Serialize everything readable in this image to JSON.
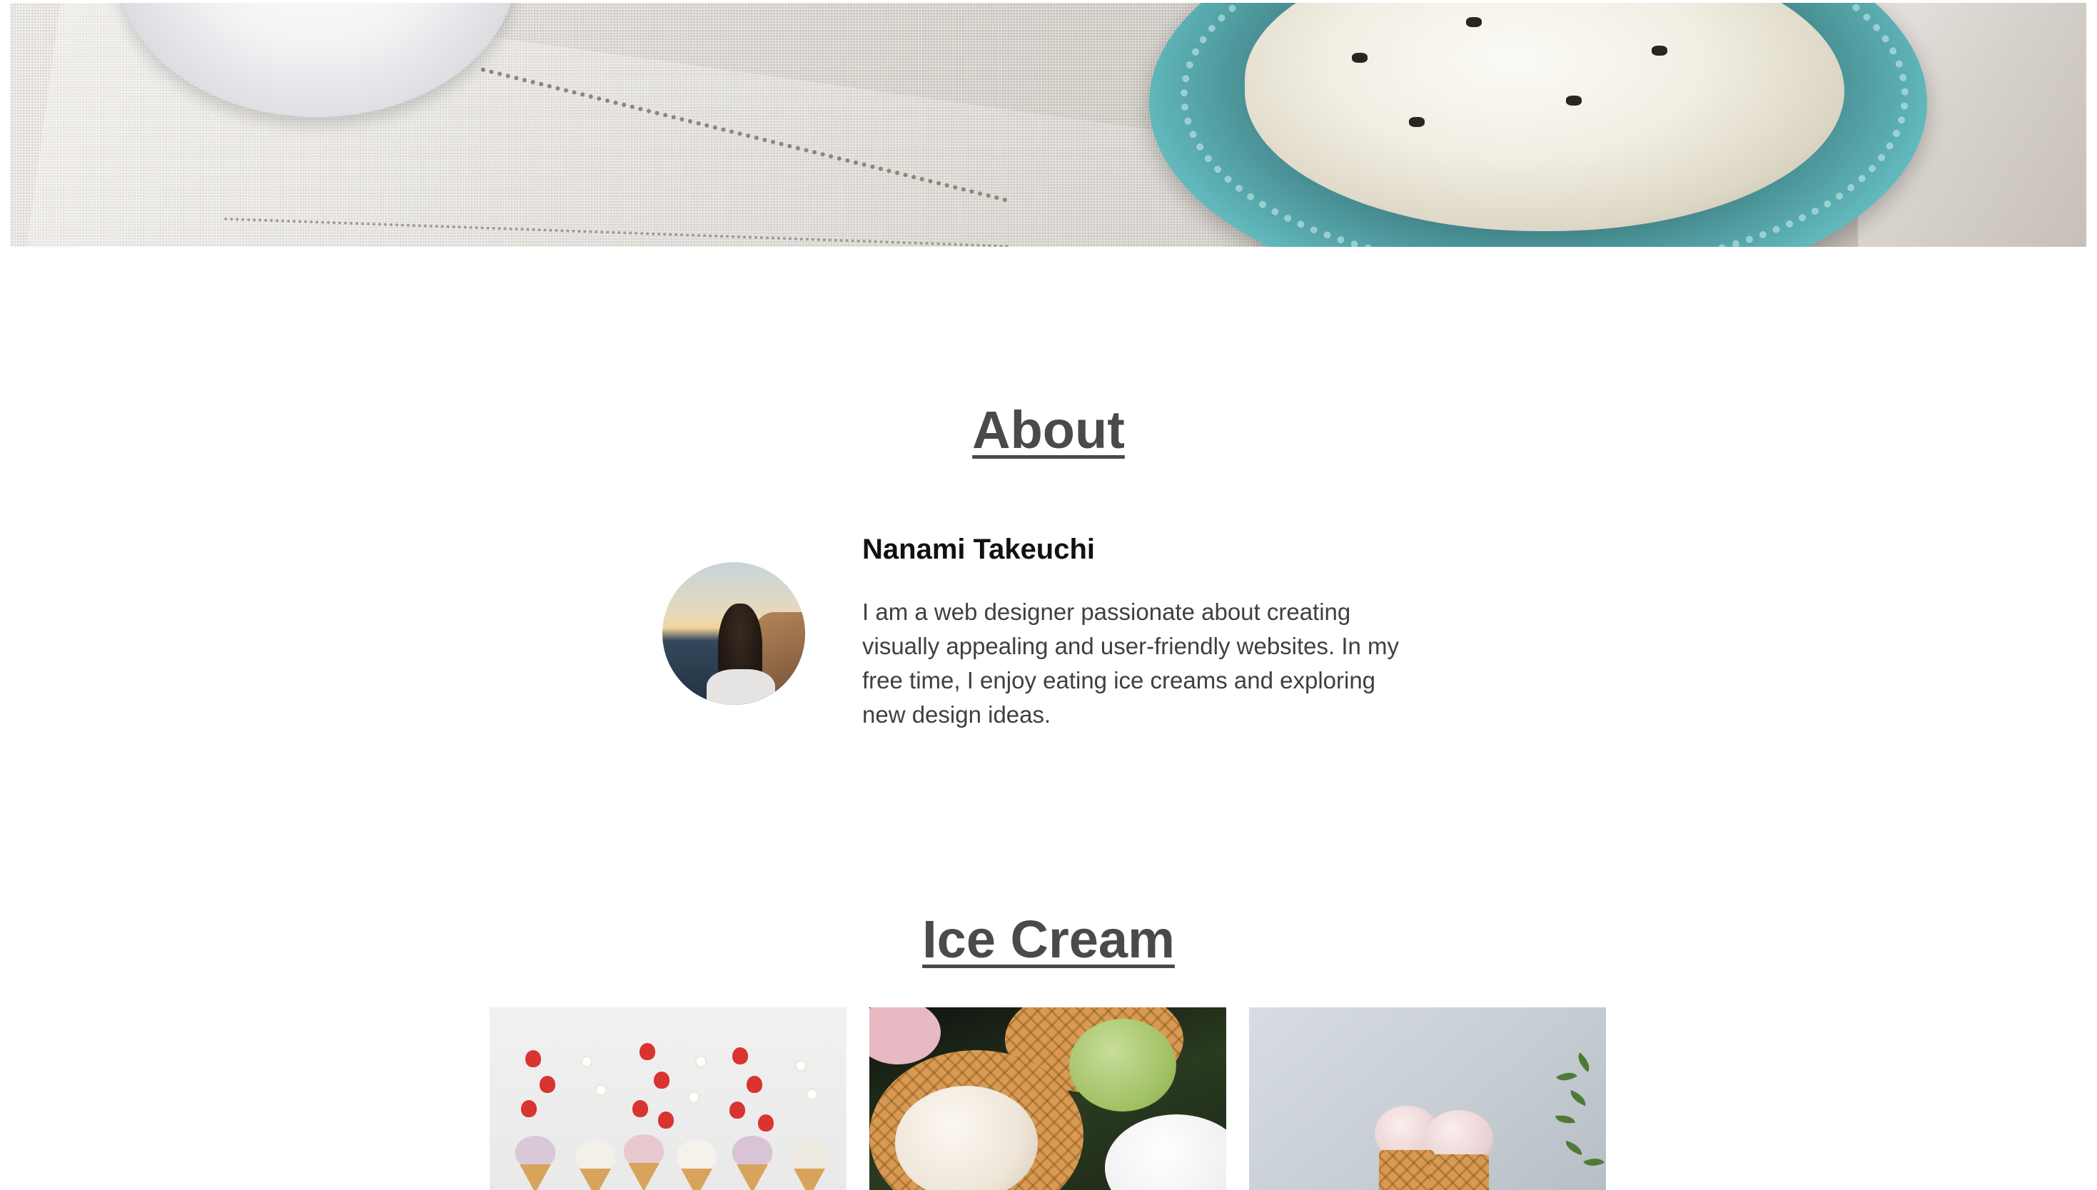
{
  "about": {
    "title": "About",
    "name": "Nanami Takeuchi",
    "bio": "I am a web designer passionate about creating visually appealing and user-friendly websites. In my free time, I enjoy eating ice creams and exploring new design ideas."
  },
  "ice_cream": {
    "title": "Ice Cream"
  }
}
